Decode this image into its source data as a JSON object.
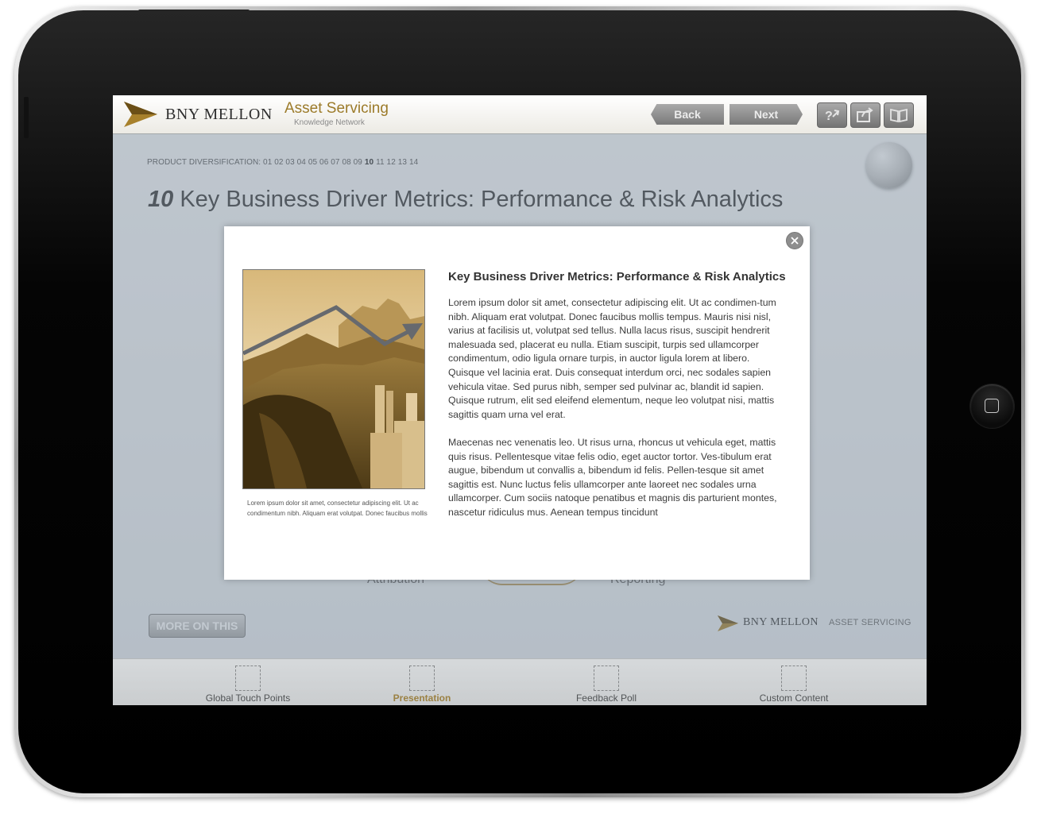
{
  "header": {
    "brand_name": "BNY MELLON",
    "brand_subtitle": "Asset Servicing",
    "brand_tagline": "Knowledge Network",
    "back_label": "Back",
    "next_label": "Next"
  },
  "breadcrumb": {
    "prefix": "PRODUCT DIVERSIFICATION: 01 02 03 04 05 06 07 08 09",
    "current": "10",
    "suffix": "11 12 13 14"
  },
  "slide": {
    "number": "10",
    "title": "Key Business Driver Metrics: Performance & Risk Analytics",
    "label_left": "Attribution",
    "label_right": "Reporting"
  },
  "more_button": "MORE ON THIS",
  "footer": {
    "brand_name": "BNY MELLON",
    "brand_sub": "ASSET SERVICING"
  },
  "tabs": [
    {
      "label": "Global Touch Points",
      "active": false
    },
    {
      "label": "Presentation",
      "active": true
    },
    {
      "label": "Feedback Poll",
      "active": false
    },
    {
      "label": "Custom Content",
      "active": false
    }
  ],
  "modal": {
    "title": "Key Business Driver Metrics: Performance & Risk Analytics",
    "paragraph1": "Lorem ipsum dolor sit amet, consectetur adipiscing elit. Ut ac condimen-tum nibh. Aliquam erat volutpat. Donec faucibus mollis tempus. Mauris nisi nisl, varius at facilisis ut, volutpat sed tellus. Nulla lacus risus, suscipit hendrerit malesuada sed, placerat eu nulla. Etiam suscipit, turpis sed ullamcorper condimentum, odio ligula ornare turpis, in auctor ligula lorem at libero. Quisque vel lacinia erat. Duis consequat interdum orci, nec sodales sapien vehicula vitae. Sed purus nibh, semper sed pulvinar ac, blandit id sapien. Quisque rutrum, elit sed eleifend elementum, neque leo volutpat nisi, mattis sagittis quam urna vel erat.",
    "paragraph2": "Maecenas nec venenatis leo. Ut risus urna, rhoncus ut vehicula eget, mattis quis risus. Pellentesque vitae felis odio, eget auctor tortor. Ves-tibulum erat augue, bibendum ut convallis a, bibendum id felis. Pellen-tesque sit amet sagittis est. Nunc luctus felis ullamcorper ante laoreet nec sodales urna ullamcorper. Cum sociis natoque penatibus et magnis dis parturient montes, nascetur ridiculus mus. Aenean tempus tincidunt",
    "caption": "Lorem ipsum dolor sit amet, consectetur adipiscing elit. Ut ac condimentum nibh. Aliquam erat volutpat. Donec faucibus mollis"
  },
  "icons": {
    "help": "help-icon",
    "share": "share-icon",
    "book": "book-icon",
    "globe": "globe-icon",
    "close": "close-icon",
    "home": "home-button-icon"
  },
  "colors": {
    "brand_gold": "#a7802b",
    "accent_gold": "#9c7b2a",
    "button_gray": "#8e8e8e"
  }
}
